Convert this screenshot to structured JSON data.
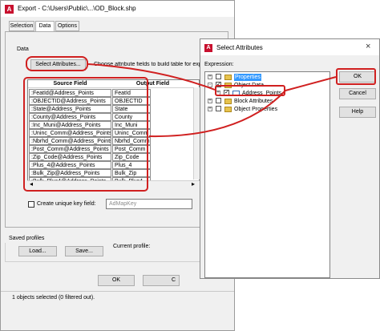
{
  "export_dialog": {
    "title": "Export - C:\\Users\\Public\\...\\OD_Block.shp",
    "tabs": [
      {
        "label": "Selection",
        "active": false
      },
      {
        "label": "Data",
        "active": true
      },
      {
        "label": "Options",
        "active": false
      }
    ],
    "data_label": "Data",
    "select_attributes_button": "Select Attributes...",
    "choose_text": "Choose attribute fields to build table for export.",
    "columns": {
      "source": "Source Field",
      "output": "Output Field"
    },
    "rows": [
      {
        "source": ":FeatId@Address_Points",
        "output": "FeatId"
      },
      {
        "source": ":OBJECTID@Address_Points",
        "output": "OBJECTID"
      },
      {
        "source": ":State@Address_Points",
        "output": "State"
      },
      {
        "source": ":County@Address_Points",
        "output": "County"
      },
      {
        "source": ":Inc_Muni@Address_Points",
        "output": "Inc_Muni"
      },
      {
        "source": ":Uninc_Comm@Address_Points",
        "output": "Uninc_Comm"
      },
      {
        "source": ":Nbrhd_Comm@Address_Points",
        "output": "Nbrhd_Comm"
      },
      {
        "source": ":Post_Comm@Address_Points",
        "output": "Post_Comm"
      },
      {
        "source": ":Zip_Code@Address_Points",
        "output": "Zip_Code"
      },
      {
        "source": ":Plus_4@Address_Points",
        "output": "Plus_4"
      },
      {
        "source": ":Bulk_Zip@Address_Points",
        "output": "Bulk_Zip"
      },
      {
        "source": ":Bulk_Plus4@Address_Points",
        "output": "Bulk_Plus4"
      }
    ],
    "unique_key_label": "Create unique key field:",
    "unique_key_value": "AdMapKey",
    "saved_profiles_label": "Saved profiles",
    "current_profile_label": "Current profile:",
    "load_button": "Load...",
    "save_button": "Save...",
    "ok_button": "OK",
    "cancel_button": "C",
    "status_text": "1 objects selected (0 filtered out)."
  },
  "select_dialog": {
    "title": "Select Attributes",
    "close_glyph": "×",
    "expression_label": "Expression:",
    "tree": [
      {
        "label": "Properties",
        "level": 0,
        "expander": "+",
        "checked": false,
        "highlighted": true,
        "icon": "folder-icon"
      },
      {
        "label": "Object Data",
        "level": 0,
        "expander": "-",
        "checked": true,
        "highlighted": false,
        "icon": "folder-icon"
      },
      {
        "label": "Address_Points",
        "level": 1,
        "expander": "+",
        "checked": true,
        "highlighted": false,
        "icon": "table-icon"
      },
      {
        "label": "Block Attributes",
        "level": 0,
        "expander": "+",
        "checked": false,
        "highlighted": false,
        "icon": "folder-icon"
      },
      {
        "label": "Object Properties",
        "level": 0,
        "expander": "+",
        "checked": false,
        "highlighted": false,
        "icon": "folder-icon"
      }
    ],
    "ok_button": "OK",
    "cancel_button": "Cancel",
    "help_button": "Help"
  },
  "icons": {
    "app_icon_glyph": "A",
    "check_glyph": "✓",
    "scroll_left": "◂",
    "scroll_right": "▸",
    "scroll_up": "▴",
    "scroll_down": "▾"
  },
  "colors": {
    "annotation_red": "#d02020",
    "highlight_blue": "#3399ff",
    "autocad_red": "#c8102e"
  }
}
